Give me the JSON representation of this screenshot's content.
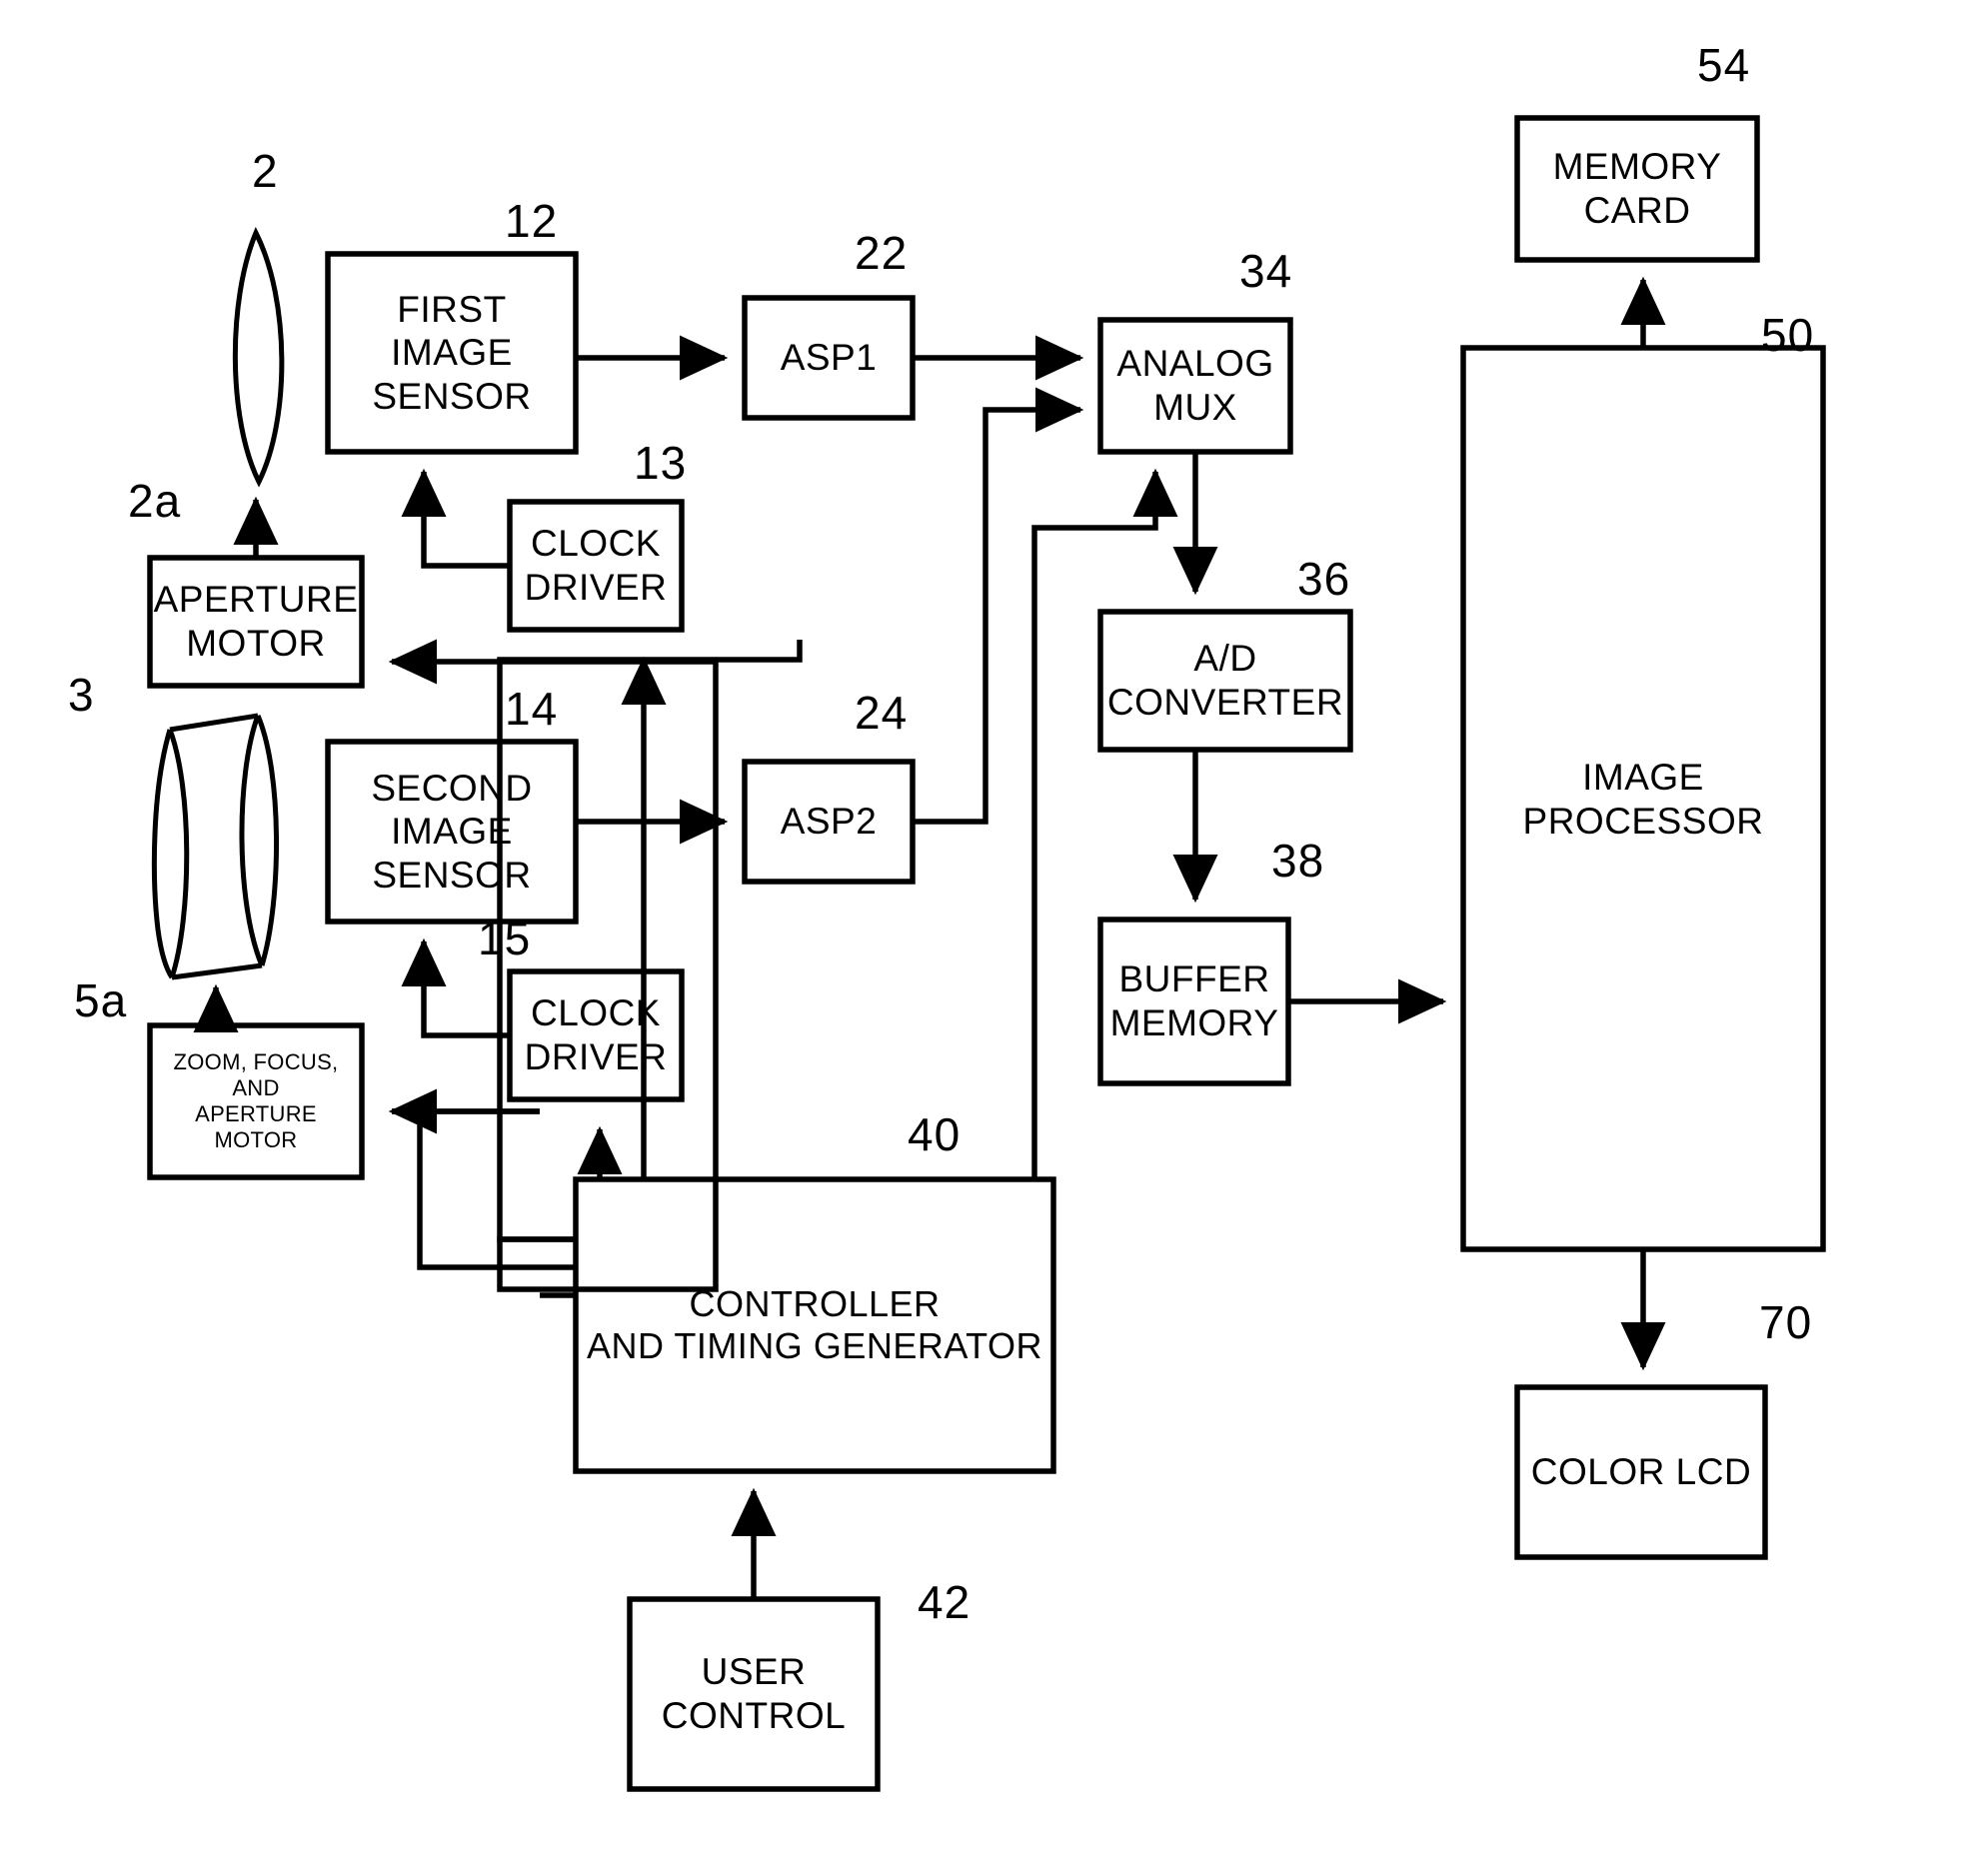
{
  "figure": {
    "kind": "patent-block-diagram",
    "subject": "Digital camera with dual image sensors"
  },
  "blocks": [
    {
      "id": "first_image_sensor",
      "label": "FIRST\nIMAGE\nSENSOR",
      "ref": "12"
    },
    {
      "id": "clock_driver_13",
      "label": "CLOCK\nDRIVER",
      "ref": "13"
    },
    {
      "id": "second_image_sensor",
      "label": "SECOND\nIMAGE\nSENSOR",
      "ref": "14"
    },
    {
      "id": "clock_driver_15",
      "label": "CLOCK\nDRIVER",
      "ref": "15"
    },
    {
      "id": "aperture_motor",
      "label": "APERTURE\nMOTOR",
      "ref": "2a"
    },
    {
      "id": "zoom_focus_motor",
      "label": "ZOOM, FOCUS,\nAND\nAPERTURE\nMOTOR",
      "ref": "5a"
    },
    {
      "id": "asp1",
      "label": "ASP1",
      "ref": "22"
    },
    {
      "id": "asp2",
      "label": "ASP2",
      "ref": "24"
    },
    {
      "id": "analog_mux",
      "label": "ANALOG\nMUX",
      "ref": "34"
    },
    {
      "id": "ad_converter",
      "label": "A/D\nCONVERTER",
      "ref": "36"
    },
    {
      "id": "buffer_memory",
      "label": "BUFFER\nMEMORY",
      "ref": "38"
    },
    {
      "id": "controller",
      "label": "CONTROLLER\nAND TIMING GENERATOR",
      "ref": "40"
    },
    {
      "id": "user_control",
      "label": "USER\nCONTROL",
      "ref": "42"
    },
    {
      "id": "memory_card",
      "label": "MEMORY\nCARD",
      "ref": "54"
    },
    {
      "id": "image_processor",
      "label": "IMAGE\nPROCESSOR",
      "ref": "50"
    },
    {
      "id": "color_lcd",
      "label": "COLOR LCD",
      "ref": "70"
    }
  ],
  "optics": [
    {
      "id": "first_lens",
      "shape": "thin-lens-ellipse",
      "ref": "2"
    },
    {
      "id": "zoom_lens",
      "shape": "cylinder",
      "ref": "3"
    }
  ],
  "reference_numerals": [
    "2",
    "2a",
    "3",
    "5a",
    "12",
    "13",
    "14",
    "15",
    "22",
    "24",
    "34",
    "36",
    "38",
    "40",
    "42",
    "50",
    "54",
    "70"
  ],
  "connections": [
    {
      "from": "aperture_motor",
      "to": "first_lens",
      "arrow": "up"
    },
    {
      "from": "zoom_focus_motor",
      "to": "zoom_lens",
      "arrow": "up"
    },
    {
      "from": "first_image_sensor",
      "to": "asp1",
      "arrow": "right"
    },
    {
      "from": "second_image_sensor",
      "to": "asp2",
      "arrow": "right"
    },
    {
      "from": "clock_driver_13",
      "to": "first_image_sensor",
      "arrow": "up"
    },
    {
      "from": "clock_driver_15",
      "to": "second_image_sensor",
      "arrow": "up"
    },
    {
      "from": "controller",
      "to": "clock_driver_13",
      "arrow": "up"
    },
    {
      "from": "controller",
      "to": "clock_driver_15",
      "arrow": "up"
    },
    {
      "from": "controller",
      "to": "aperture_motor",
      "arrow": "left"
    },
    {
      "from": "controller",
      "to": "zoom_focus_motor",
      "arrow": "left"
    },
    {
      "from": "controller",
      "to": "analog_mux",
      "arrow": "up"
    },
    {
      "from": "asp1",
      "to": "analog_mux",
      "arrow": "right"
    },
    {
      "from": "asp2",
      "to": "analog_mux",
      "arrow": "right"
    },
    {
      "from": "analog_mux",
      "to": "ad_converter",
      "arrow": "down"
    },
    {
      "from": "ad_converter",
      "to": "buffer_memory",
      "arrow": "down"
    },
    {
      "from": "buffer_memory",
      "to": "image_processor",
      "arrow": "right"
    },
    {
      "from": "image_processor",
      "to": "memory_card",
      "arrow": "up"
    },
    {
      "from": "image_processor",
      "to": "color_lcd",
      "arrow": "down"
    },
    {
      "from": "user_control",
      "to": "controller",
      "arrow": "up"
    }
  ],
  "colors": {
    "line": "#000000",
    "background": "#ffffff",
    "text": "#000000"
  }
}
